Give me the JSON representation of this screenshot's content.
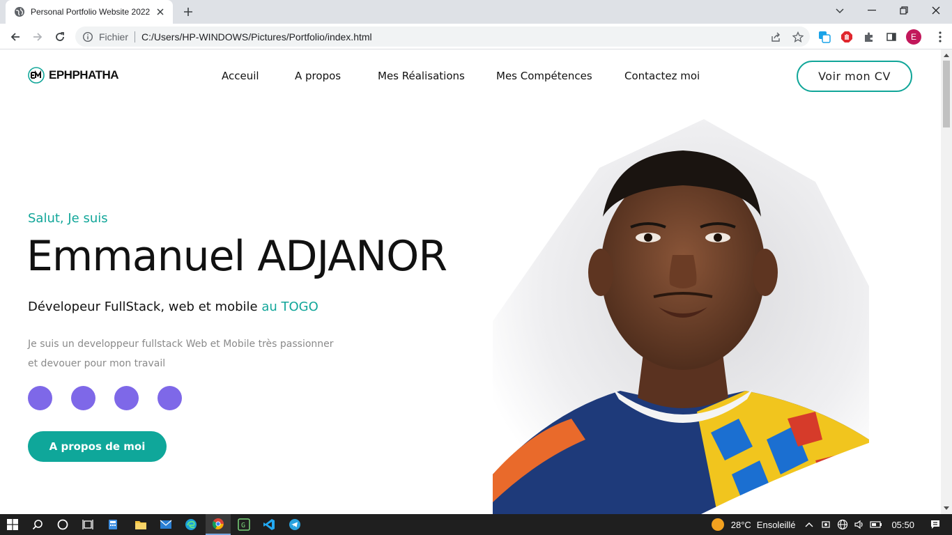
{
  "browser": {
    "tab_title": "Personal Portfolio Website 2022",
    "omnibox_scheme": "Fichier",
    "url": "C:/Users/HP-WINDOWS/Pictures/Portfolio/index.html",
    "profile_initial": "E"
  },
  "site": {
    "logo_text": "EPHPHATHA",
    "nav": [
      "Acceuil",
      "A propos",
      "Mes Réalisations",
      "Mes Compétences",
      "Contactez moi"
    ],
    "cv_button": "Voir mon CV"
  },
  "hero": {
    "greeting": "Salut, Je suis",
    "name": "Emmanuel ADJANOR",
    "role_prefix": "Dévelopeur FullStack, web et mobile",
    "role_accent": "au TOGO",
    "bio_line1": "Je suis un developpeur fullstack Web et Mobile très passionner",
    "bio_line2": "et devouer pour mon travail",
    "social_count": 4,
    "about_button": "A propos de moi",
    "accent_color": "#11a699",
    "social_color": "#7e68e8"
  },
  "taskbar": {
    "temperature": "28°C",
    "weather": "Ensoleillé",
    "time": "05:50"
  }
}
